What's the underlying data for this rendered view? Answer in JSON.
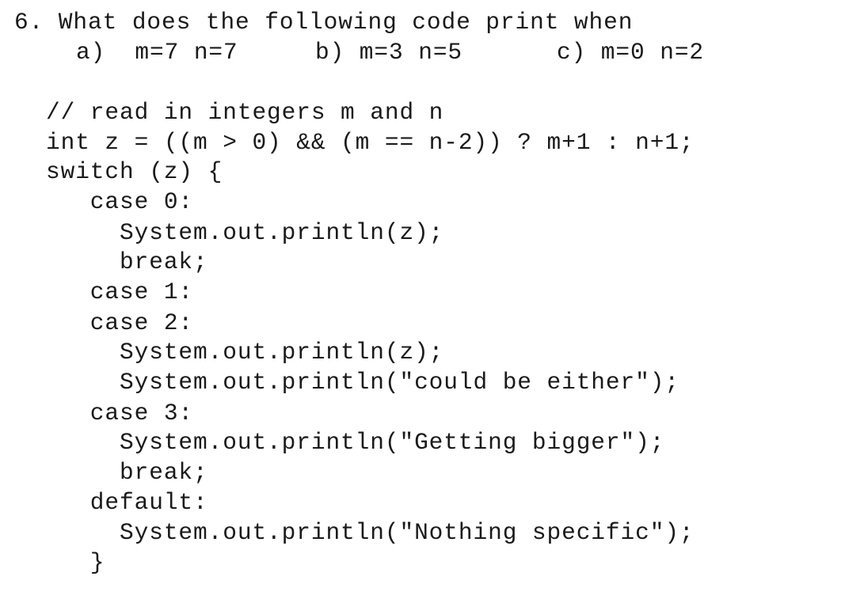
{
  "question": {
    "title": "6. What does the following code print when",
    "options": [
      {
        "label": "a)",
        "text": "a)  m=7 n=7"
      },
      {
        "label": "b)",
        "text": "b) m=3 n=5"
      },
      {
        "label": "c)",
        "text": "c) m=0 n=2"
      }
    ]
  },
  "code": {
    "lines": [
      "// read in integers m and n",
      "int z = ((m > 0) && (m == n-2)) ? m+1 : n+1;",
      "switch (z) {",
      "   case 0:",
      "     System.out.println(z);",
      "     break;",
      "   case 1:",
      "   case 2:",
      "     System.out.println(z);",
      "     System.out.println(\"could be either\");",
      "   case 3:",
      "     System.out.println(\"Getting bigger\");",
      "     break;",
      "   default:",
      "     System.out.println(\"Nothing specific\");",
      "   }"
    ]
  }
}
